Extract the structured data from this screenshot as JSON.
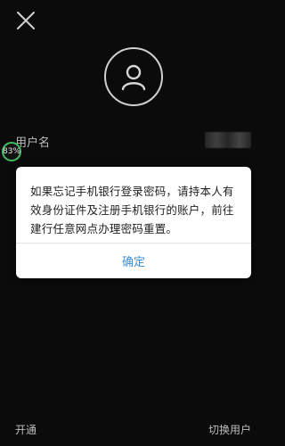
{
  "icons": {
    "close": "close-icon",
    "avatar": "user-icon"
  },
  "login": {
    "username_label": "用户名",
    "progress_text": "83%"
  },
  "dialog": {
    "message": "如果忘记手机银行登录密码，请持本人有效身份证件及注册手机银行的账户，前往建行任意网点办理密码重置。",
    "confirm_label": "确定"
  },
  "footer": {
    "open_label": "开通",
    "switch_user_label": "切换用户"
  },
  "colors": {
    "background": "#0b0b0b",
    "dialog_bg": "#ffffff",
    "confirm_text": "#3a8fd9",
    "progress_ring": "#3fbf5f"
  }
}
